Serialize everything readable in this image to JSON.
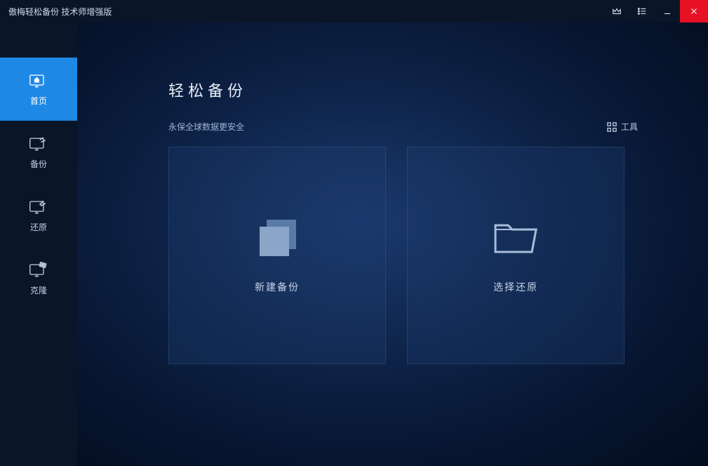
{
  "titlebar": {
    "title": "傲梅轻松备份 技术师增强版"
  },
  "sidebar": {
    "items": [
      {
        "label": "首页"
      },
      {
        "label": "备份"
      },
      {
        "label": "还原"
      },
      {
        "label": "克隆"
      }
    ]
  },
  "main": {
    "title": "轻松备份",
    "subtitle": "永保全球数据更安全",
    "tools_label": "工具",
    "cards": [
      {
        "label": "新建备份"
      },
      {
        "label": "选择还原"
      }
    ]
  }
}
